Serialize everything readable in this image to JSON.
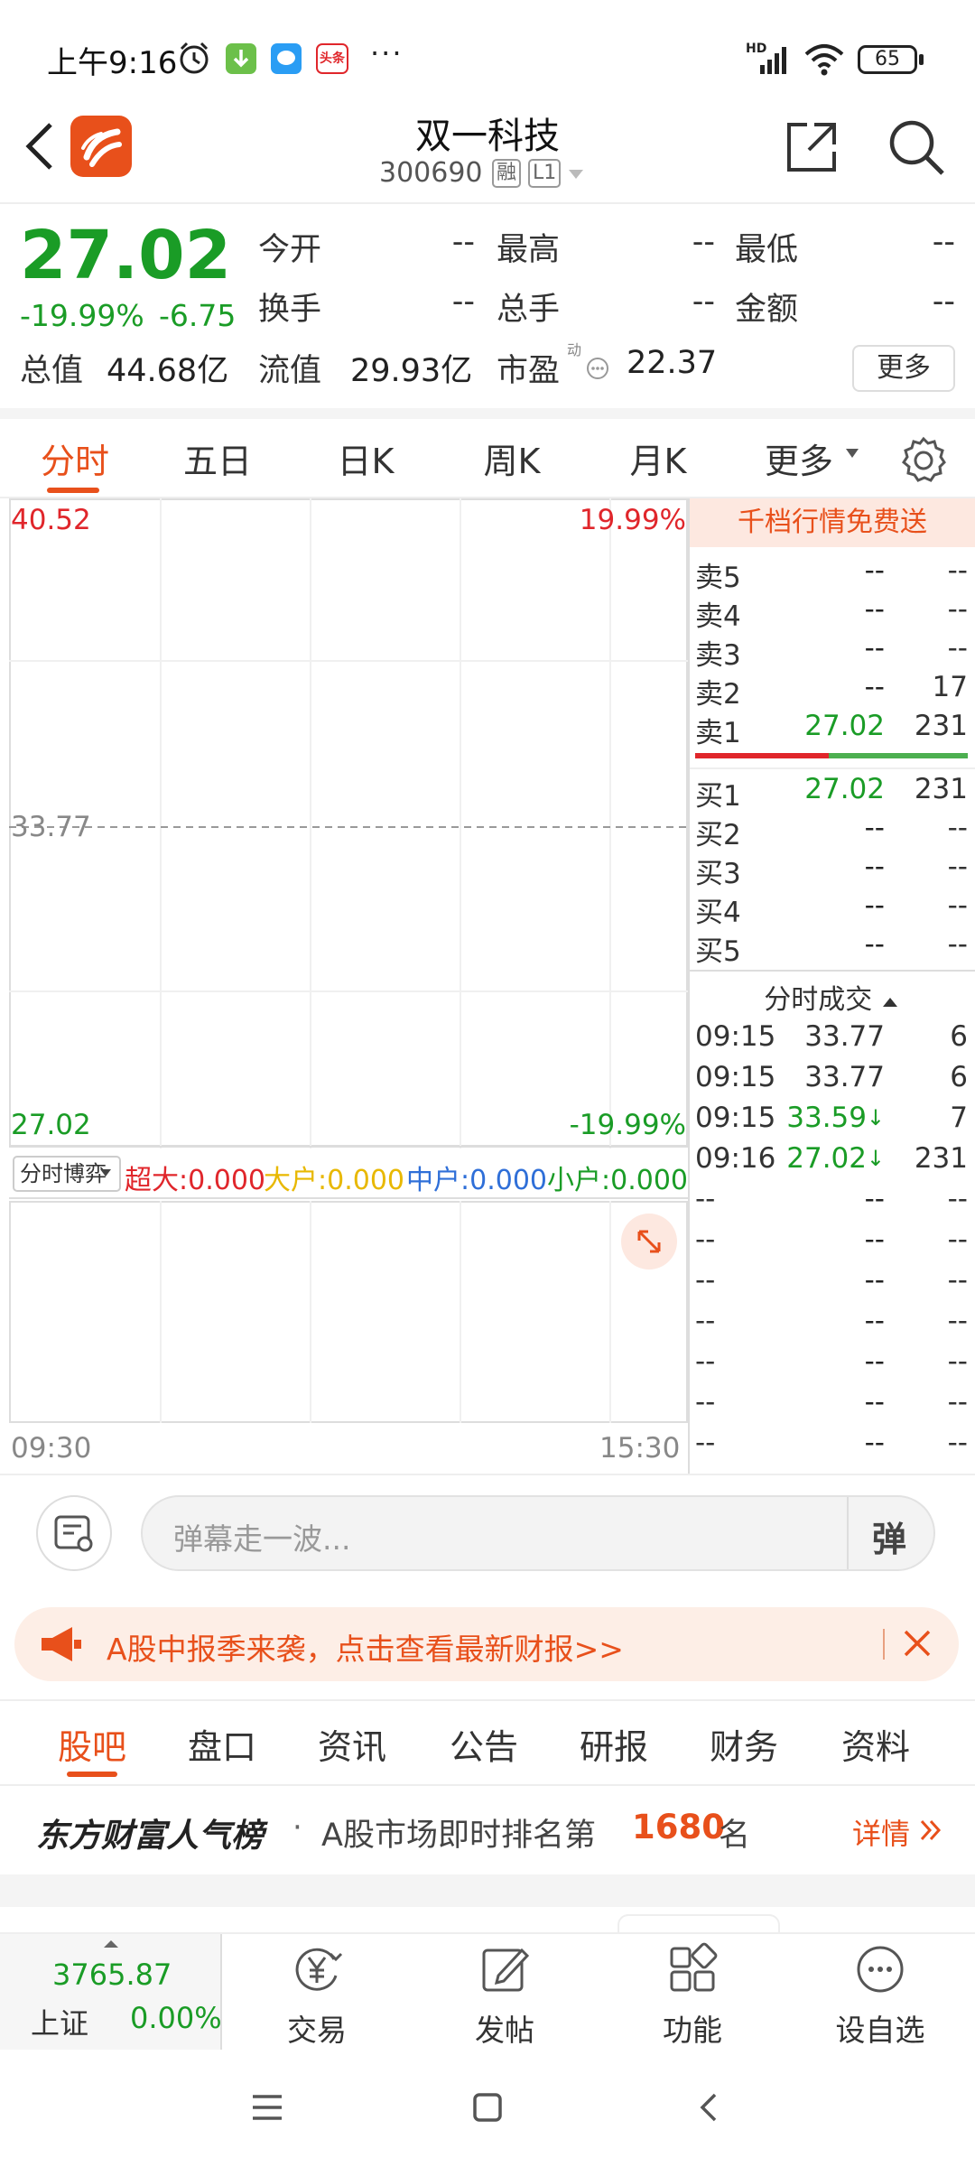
{
  "status_bar": {
    "time": "上午9:16",
    "toutiao_badge": "头条",
    "more_dots": "···",
    "network": "HD",
    "battery": "65"
  },
  "header": {
    "stock_name": "双一科技",
    "stock_code": "300690",
    "tag_rong": "融",
    "tag_level": "L1"
  },
  "quote": {
    "price": "27.02",
    "change_pct": "-19.99%",
    "change_amt": "-6.75",
    "open_label": "今开",
    "open_val": "--",
    "high_label": "最高",
    "high_val": "--",
    "low_label": "最低",
    "low_val": "--",
    "turnover_label": "换手",
    "turnover_val": "--",
    "volume_label": "总手",
    "volume_val": "--",
    "amount_label": "金额",
    "amount_val": "--",
    "mktcap_label": "总值",
    "mktcap_val": "44.68亿",
    "float_label": "流值",
    "float_val": "29.93亿",
    "pe_label": "市盈",
    "pe_sup": "动",
    "pe_val": "22.37",
    "more_btn": "更多"
  },
  "chart_tabs": [
    "分时",
    "五日",
    "日K",
    "周K",
    "月K",
    "更多"
  ],
  "chart": {
    "top_price": "40.52",
    "top_pct": "19.99%",
    "mid_price": "33.77",
    "bot_price": "27.02",
    "bot_pct": "-19.99%",
    "flow_select": "分时博弈",
    "flow_super": "超大:0.000",
    "flow_big": "大户:0.000",
    "flow_mid": "中户:0.000",
    "flow_small": "小户:0.000",
    "time_start": "09:30",
    "time_end": "15:30"
  },
  "order_book": {
    "promo": "千档行情免费送",
    "asks": [
      {
        "label": "卖5",
        "price": "--",
        "vol": "--"
      },
      {
        "label": "卖4",
        "price": "--",
        "vol": "--"
      },
      {
        "label": "卖3",
        "price": "--",
        "vol": "--"
      },
      {
        "label": "卖2",
        "price": "--",
        "vol": "17"
      },
      {
        "label": "卖1",
        "price": "27.02",
        "vol": "231"
      }
    ],
    "bids": [
      {
        "label": "买1",
        "price": "27.02",
        "vol": "231"
      },
      {
        "label": "买2",
        "price": "--",
        "vol": "--"
      },
      {
        "label": "买3",
        "price": "--",
        "vol": "--"
      },
      {
        "label": "买4",
        "price": "--",
        "vol": "--"
      },
      {
        "label": "买5",
        "price": "--",
        "vol": "--"
      }
    ]
  },
  "trades": {
    "title": "分时成交",
    "rows": [
      {
        "time": "09:15",
        "price": "33.77",
        "arrow": "",
        "vol": "6"
      },
      {
        "time": "09:15",
        "price": "33.77",
        "arrow": "",
        "vol": "6"
      },
      {
        "time": "09:15",
        "price": "33.59",
        "arrow": "↓",
        "vol": "7"
      },
      {
        "time": "09:16",
        "price": "27.02",
        "arrow": "↓",
        "vol": "231"
      },
      {
        "time": "--",
        "price": "--",
        "arrow": "",
        "vol": "--"
      },
      {
        "time": "--",
        "price": "--",
        "arrow": "",
        "vol": "--"
      },
      {
        "time": "--",
        "price": "--",
        "arrow": "",
        "vol": "--"
      },
      {
        "time": "--",
        "price": "--",
        "arrow": "",
        "vol": "--"
      },
      {
        "time": "--",
        "price": "--",
        "arrow": "",
        "vol": "--"
      },
      {
        "time": "--",
        "price": "--",
        "arrow": "",
        "vol": "--"
      },
      {
        "time": "--",
        "price": "--",
        "arrow": "",
        "vol": "--"
      }
    ]
  },
  "danmu": {
    "placeholder": "弹幕走一波...",
    "send_glyph": "弹"
  },
  "banner": {
    "text": "A股中报季来袭，点击查看最新财报>>"
  },
  "content_tabs": [
    "股吧",
    "盘口",
    "资讯",
    "公告",
    "研报",
    "财务",
    "资料"
  ],
  "rank": {
    "brand": "东方财富人气榜",
    "dot": "·",
    "text_pre": "A股市场即时排名第",
    "rank_num": "1680",
    "text_post": "名",
    "detail": "详情"
  },
  "bottom_bar": {
    "index_value": "3765.87",
    "index_name": "上证",
    "index_pct": "0.00%",
    "items": [
      "交易",
      "发帖",
      "功能",
      "设自选"
    ]
  },
  "colors": {
    "up": "#e0262b",
    "down": "#1a9c26",
    "accent": "#e8501b"
  }
}
